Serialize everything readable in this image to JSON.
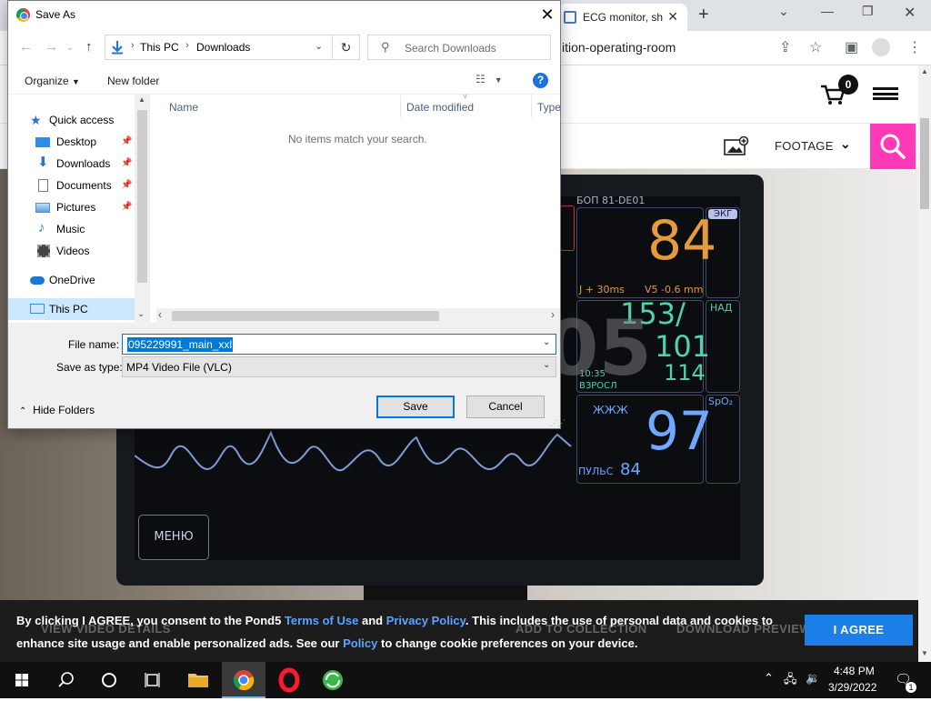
{
  "browser": {
    "tab_title": "ECG monitor, sh",
    "url_fragment": "ition-operating-room"
  },
  "site": {
    "cart_count": "0",
    "footage_label": "FOOTAGE",
    "accent_color": "#ff39b8"
  },
  "video": {
    "monitor_id": "БОП 81-DE01",
    "ecg_tag": "ЭКГ",
    "hr_value": "84",
    "st_left": "J + 30ms",
    "st_right": "V5 -0.6 mm",
    "nad_tag": "НАД",
    "bp_sys": "153/",
    "bp_dia": "101",
    "bp_mean": "114",
    "bp_time": "10:35",
    "bp_mode": "ВЗРОСЛ",
    "spo2_tag": "SpO₂",
    "spo2_sub": "ЖЖЖ",
    "spo2_value": "97",
    "pulse_label": "ПУЛЬС",
    "pulse_value": "84",
    "menu_label": "МЕНЮ",
    "watermark": "05"
  },
  "cookie": {
    "text_1": "By clicking I AGREE, you consent to the Pond5 ",
    "link_terms": "Terms of Use",
    "text_2": " and ",
    "link_privacy": "Privacy Policy",
    "text_3": ". This includes the use of personal data and cookies to enhance site usage and enable personalized ads. See our ",
    "link_policy": "Policy",
    "text_4": " to change cookie preferences on your device.",
    "agree_label": "I AGREE",
    "ghost_view": "VIEW VIDEO DETAILS",
    "ghost_collection": "ADD TO COLLECTION",
    "ghost_download": "DOWNLOAD PREVIEW"
  },
  "dialog": {
    "title": "Save As",
    "address_root": "This PC",
    "address_folder": "Downloads",
    "search_placeholder": "Search Downloads",
    "organize_label": "Organize",
    "new_folder_label": "New folder",
    "nav_items": [
      {
        "label": "Quick access"
      },
      {
        "label": "Desktop"
      },
      {
        "label": "Downloads"
      },
      {
        "label": "Documents"
      },
      {
        "label": "Pictures"
      },
      {
        "label": "Music"
      },
      {
        "label": "Videos"
      },
      {
        "label": "OneDrive"
      },
      {
        "label": "This PC"
      }
    ],
    "columns": [
      "Name",
      "Date modified",
      "Type"
    ],
    "empty_message": "No items match your search.",
    "file_name_label": "File name:",
    "file_name_value": "095229991_main_xxl",
    "save_type_label": "Save as type:",
    "save_type_value": "MP4 Video File (VLC)",
    "hide_folders_label": "Hide Folders",
    "save_label": "Save",
    "cancel_label": "Cancel"
  },
  "taskbar": {
    "time": "4:48 PM",
    "date": "3/29/2022",
    "notification_count": "1"
  }
}
